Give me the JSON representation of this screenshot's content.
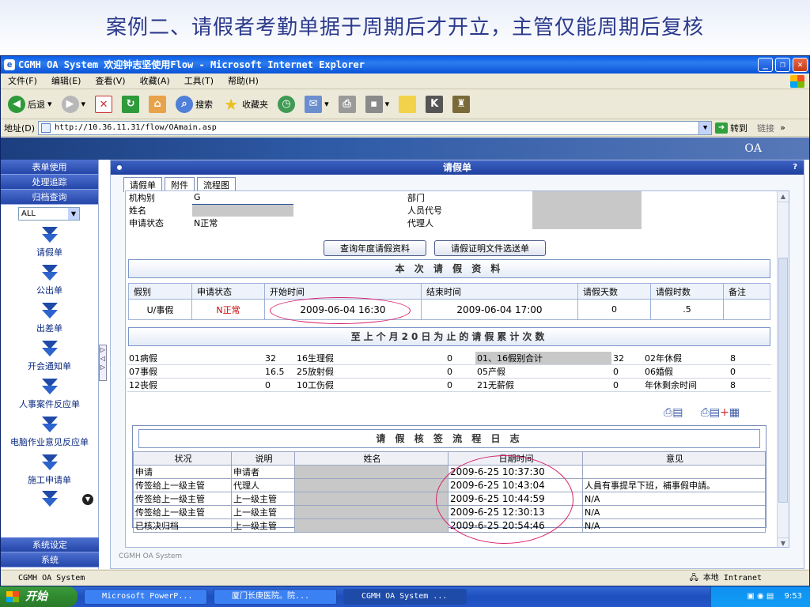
{
  "slide": {
    "title": "案例二、请假者考勤单据于周期后才开立，主管仅能周期后复核"
  },
  "window": {
    "title": "CGMH OA System 欢迎钟志坚使用Flow - Microsoft Internet Explorer"
  },
  "menu": [
    "文件(F)",
    "编辑(E)",
    "查看(V)",
    "收藏(A)",
    "工具(T)",
    "帮助(H)"
  ],
  "toolbar": {
    "back": "后退",
    "search": "搜索",
    "favorites": "收藏夹"
  },
  "address": {
    "label": "地址(D)",
    "url": "http://10.36.11.31/flow/OAmain.asp",
    "go": "转到",
    "links": "链接"
  },
  "banner": {
    "text": "OA"
  },
  "nav": {
    "top": [
      "表单使用",
      "处理追踪",
      "归档查询"
    ],
    "select_value": "ALL",
    "items": [
      "请假单",
      "公出单",
      "出差单",
      "开会通知单",
      "人事案件反应单",
      "电脑作业意见反应单",
      "施工申请单"
    ],
    "bottom": [
      "系统设定",
      "系统"
    ]
  },
  "panel": {
    "title": "请假单",
    "help": "?"
  },
  "tabs": [
    "请假单",
    "附件",
    "流程图"
  ],
  "form": {
    "org_label": "机构别",
    "org_value": "G",
    "dept_label": "部门",
    "name_label": "姓名",
    "emp_label": "人员代号",
    "status_label": "申请状态",
    "status_value": "N正常",
    "agent_label": "代理人"
  },
  "buttons": {
    "annual": "查询年度请假资料",
    "proof": "请假证明文件选送单"
  },
  "section1": "本 次 请 假 资 料",
  "leave": {
    "headers": [
      "假别",
      "申请状态",
      "开始时间",
      "结束时间",
      "请假天数",
      "请假时数",
      "备注"
    ],
    "row": [
      "U/事假",
      "N正常",
      "2009-06-04 16:30",
      "2009-06-04 17:00",
      "0",
      ".5",
      ""
    ]
  },
  "section2": "至上个月20日为止的请假累计次数",
  "counts": [
    [
      "01病假",
      "32",
      "16生理假",
      "0",
      "01、16假别合计",
      "32",
      "02年休假",
      "8"
    ],
    [
      "07事假",
      "16.5",
      "25放射假",
      "0",
      "05产假",
      "0",
      "06婚假",
      "0"
    ],
    [
      "12丧假",
      "0",
      "10工伤假",
      "0",
      "21无薪假",
      "0",
      "年休剩余时间",
      "8"
    ]
  ],
  "section3": "请 假 核 签 流 程 日 志",
  "log": {
    "headers": [
      "状况",
      "说明",
      "姓名",
      "日期时间",
      "意见"
    ],
    "rows": [
      [
        "申请",
        "申请者",
        "",
        "2009-6-25 10:37:30",
        ""
      ],
      [
        "传签给上一级主管",
        "代理人",
        "",
        "2009-6-25 10:43:04",
        "人員有事提早下班，補事假申請。"
      ],
      [
        "传签给上一级主管",
        "上一级主管",
        "",
        "2009-6-25 10:44:59",
        "N/A"
      ],
      [
        "传签给上一级主管",
        "上一级主管",
        "",
        "2009-6-25 12:30:13",
        "N/A"
      ],
      [
        "已核决归档",
        "上一级主管",
        "",
        "2009-6-25 20:54:46",
        "N/A"
      ]
    ]
  },
  "footer_brand": "CGMH OA System",
  "statusbar": {
    "left": "CGMH OA System",
    "zone": "本地 Intranet"
  },
  "taskbar": {
    "start": "开始",
    "tasks": [
      "Microsoft PowerP...",
      "厦门长庚医院。院...",
      "CGMH OA System ..."
    ],
    "clock": "9:53"
  },
  "colors": {
    "accent": "#2446a8",
    "highlight": "#d8206a",
    "status_red": "#cc0000"
  }
}
